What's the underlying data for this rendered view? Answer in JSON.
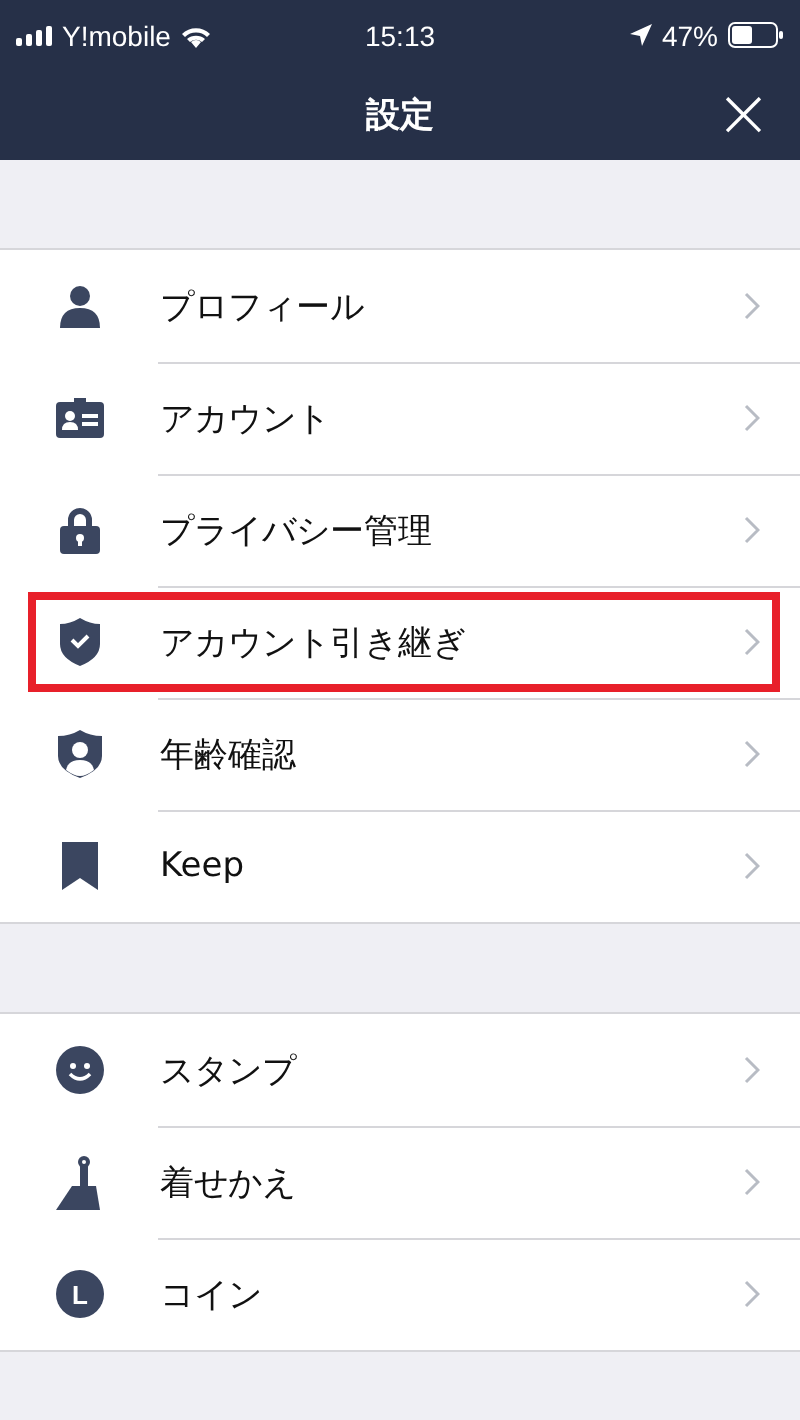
{
  "status_bar": {
    "carrier": "Y!mobile",
    "time": "15:13",
    "battery": "47%"
  },
  "header": {
    "title": "設定",
    "close": "×"
  },
  "sections": [
    {
      "items": [
        {
          "label": "プロフィール",
          "highlighted": false
        },
        {
          "label": "アカウント",
          "highlighted": false
        },
        {
          "label": "プライバシー管理",
          "highlighted": false
        },
        {
          "label": "アカウント引き継ぎ",
          "highlighted": true
        },
        {
          "label": "年齢確認",
          "highlighted": false
        },
        {
          "label": "Keep",
          "highlighted": false
        }
      ]
    },
    {
      "items": [
        {
          "label": "スタンプ",
          "highlighted": false
        },
        {
          "label": "着せかえ",
          "highlighted": false
        },
        {
          "label": "コイン",
          "icon_letter": "L",
          "highlighted": false
        }
      ]
    }
  ]
}
